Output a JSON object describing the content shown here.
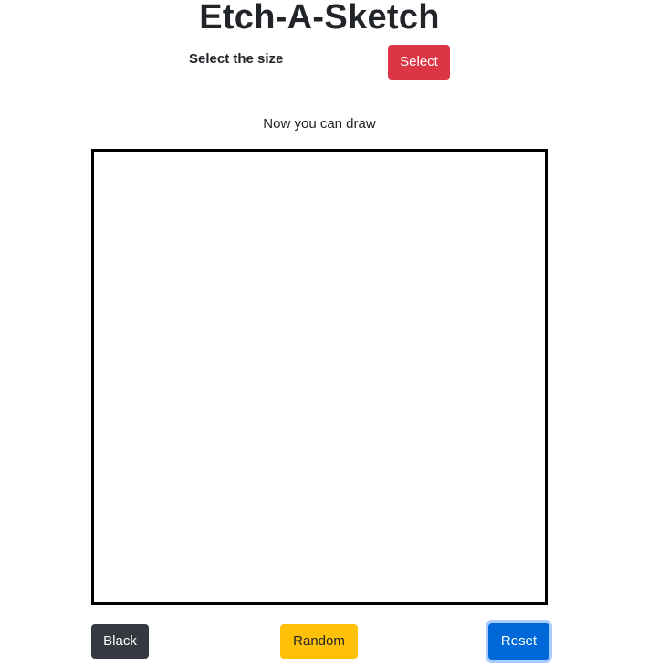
{
  "app": {
    "title": "Etch-A-Sketch"
  },
  "size_picker": {
    "label": "Select the size",
    "button_label": "Select",
    "button_color": "#dc3545"
  },
  "instruction": "Now you can draw",
  "canvas": {
    "border_color": "#000000",
    "background": "#ffffff"
  },
  "controls": {
    "black_label": "Black",
    "black_color": "#343a40",
    "random_label": "Random",
    "random_color": "#ffc107",
    "reset_label": "Reset",
    "reset_color": "#0069d9"
  }
}
